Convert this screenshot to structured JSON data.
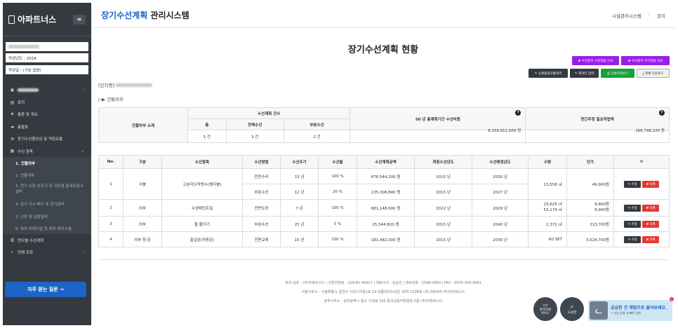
{
  "sidebar": {
    "logo": "아파트너스",
    "toggle": "≡",
    "year_label": "작성년도 : 2024",
    "version_label": "작성일 : (구분 없음)",
    "menu": [
      {
        "label": "표지",
        "icon": "book-icon"
      },
      {
        "label": "총론 및 개요",
        "icon": "flag-icon"
      },
      {
        "label": "총괄표",
        "icon": "cloud-icon"
      },
      {
        "label": "장기수선충당금 및 적립요율",
        "icon": "list-icon"
      },
      {
        "label": "수선 항목",
        "icon": "grid-icon"
      }
    ],
    "submenu": [
      "1. 건물외부",
      "2. 건물내부",
      "3. 전기·소화·승강기 및 지능형 홈네트워크설비",
      "4. 급수·가스·배수 및 환기설비",
      "5. 난방 및 급탕설비",
      "6. 옥외 부대시설 및 옥외 복리시설"
    ],
    "menu_after": [
      {
        "label": "연도별 수선계획",
        "icon": "calendar-icon"
      },
      {
        "label": "전체 조회",
        "icon": "search-icon"
      }
    ],
    "faq_label": "자주 묻는 질문 →"
  },
  "header": {
    "title_accent": "장기수선계획",
    "title_rest": " 관리시스템",
    "nav": [
      "시설관리시스템",
      "|",
      "공지"
    ]
  },
  "page": {
    "title": "장기수선계획 현황",
    "buttons": {
      "guide1": "✚ 수선항목 수량방법 안내",
      "guide2": "✚ 수선항목 추가방법 안내",
      "detail": "✎ 상세물량산출내역",
      "data_input": "✎ 데이터 입력",
      "print": "⎙ 인쇄미리보기",
      "excel": "⤓ 엑셀 다운로드"
    },
    "complex_label": "[단지명]",
    "section_label": "▷▶ 건물외부"
  },
  "summary": {
    "h_title": "건물외부 소계",
    "h_count": "수선계획 건수",
    "h_cost": "50 년 총계획기간 수선비용",
    "h_annual": "연간추정 필요적립액",
    "h_total": "총",
    "h_full": "전체수선",
    "h_partial": "부분수선",
    "total": "5 건",
    "full": "3 건",
    "partial": "2 건",
    "cost": "8,339,911,000 원",
    "annual": "166,798,220 원"
  },
  "table": {
    "headers": [
      "No.",
      "구분",
      "수선항목",
      "수선방법",
      "수선주기",
      "수선율",
      "수선계획금액",
      "최종수선년도",
      "수선예정년도",
      "수량",
      "단가",
      "⚙"
    ],
    "edit_label": "✎ 수정",
    "delete_label": "✖ 삭제",
    "rows": [
      {
        "no": "1",
        "category": "지붕",
        "item": "고분자도막방수(평지붕)",
        "subs": [
          {
            "method": "전면수리",
            "cycle": "15 년",
            "rate": "100 %",
            "amount": "676,544,200 원",
            "last": "2015 년",
            "next": "2030 년"
          },
          {
            "method": "부분수선",
            "cycle": "12 년",
            "rate": "20 %",
            "amount": "135,308,840 원",
            "last": "2015 년",
            "next": "2027 년"
          }
        ],
        "qty": "13,558 ㎡",
        "price": "49,900원"
      },
      {
        "no": "2",
        "category": "외부",
        "item": "수성페인트칠",
        "subs": [
          {
            "method": "전면도장",
            "cycle": "7 년",
            "rate": "100 %",
            "amount": "681,148,600 원",
            "last": "2022 년",
            "next": "2029 년"
          }
        ],
        "qty": "23,625 ㎡\n53,174 ㎡",
        "price": "8,800원\n8,900원"
      },
      {
        "no": "3",
        "category": "외부",
        "item": "돌 붙이기",
        "subs": [
          {
            "method": "부분수선",
            "cycle": "25 년",
            "rate": "5 %",
            "amount": "25,344,820 원",
            "last": "2015 년",
            "next": "2040 년"
          }
        ],
        "qty": "2,372 ㎡",
        "price": "213,700원"
      },
      {
        "no": "4",
        "category": "외부 창·문",
        "item": "출입문(자동문)",
        "subs": [
          {
            "method": "전면교체",
            "cycle": "15 년",
            "rate": "100 %",
            "amount": "181,482,000 원",
            "last": "2015 년",
            "next": "2030 년"
          }
        ],
        "qty": "60 SET",
        "price": "3,024,700원"
      }
    ]
  },
  "footer": {
    "line1": "회사 상호 : (주)아파트너스   |   사업자번호 : 229-81-40617   |   대표이사 : 김승민   |   대표전화 : 1566-4963   |   FAX : 0505-300-4963",
    "line2": "서울사무소 : 서울특별시 금천구 가산디지털1로 19 대륭테크노타운 18차 1208호 (우) 08594 (주)아파트너스",
    "line3": "광주사무소 : 광주광역시 동구 구성로 190 중국교동커뮤빌딩 2층 (주)아파트너스"
  },
  "floating": {
    "consult": "원격지원\n서비스",
    "manual": "도움말",
    "chat_title": "궁금한 건 채팅으로 물어보세요.",
    "chat_sub": "↑ 상담 운영 내 빠른 답변",
    "chat_close": "×"
  }
}
